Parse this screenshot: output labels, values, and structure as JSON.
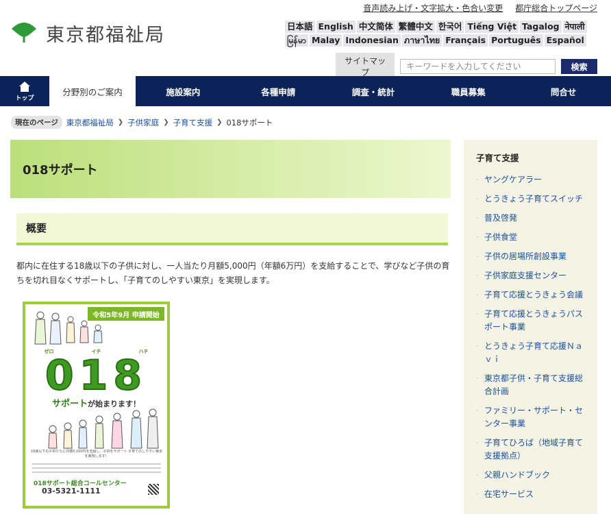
{
  "header": {
    "utility_links": [
      "音声読み上げ・文字拡大・色合い変更",
      "都庁総合トップページ"
    ],
    "logo_text": "東京都福祉局",
    "languages": [
      "日本語",
      "English",
      "中文简体",
      "繁體中文",
      "한국어",
      "Tiếng Việt",
      "Tagalog",
      "नेपाली",
      "မြန်မာ",
      "Malay",
      "Indonesian",
      "ภาษาไทย",
      "Français",
      "Português",
      "Español"
    ],
    "sitemap_label": "サイトマップ",
    "search_placeholder": "キーワードを入力してください",
    "search_button": "検索"
  },
  "nav": {
    "home_label": "トップ",
    "items": [
      "分野別のご案内",
      "施設案内",
      "各種申請",
      "調査・統計",
      "職員募集",
      "問合せ"
    ]
  },
  "breadcrumb": {
    "label": "現在のページ",
    "items": [
      "東京都福祉局",
      "子供家庭",
      "子育て支援"
    ],
    "current": "018サポート"
  },
  "main": {
    "title": "018サポート",
    "section_title": "概要",
    "body_text": "都内に在住する18歳以下の子供に対し、一人当たり月額5,000円（年額6万円）を支給することで、学びなど子供の育ちを切れ目なくサポートし、「子育てのしやすい東京」を実現します。",
    "poster": {
      "banner": "令和5年9月 申請開始",
      "kana": [
        "ゼロ",
        "イチ",
        "ハチ"
      ],
      "big_number": "018",
      "subtitle_strong": "サポート",
      "subtitle_rest": "が始まります！",
      "info_text": "18歳以下の子供たちに月額5,000円を支給し、子供をサポート 子育てのしやすい東京 を実現します！",
      "call_center": "018サポート総合コールセンター",
      "tel": "03-5321-1111"
    }
  },
  "sidebar": {
    "title": "子育て支援",
    "items": [
      "ヤングケアラー",
      "とうきょう子育てスイッチ",
      "普及啓発",
      "子供食堂",
      "子供の居場所創設事業",
      "子供家庭支援センター",
      "子育て応援とうきょう会議",
      "子育て応援とうきょうパスポート事業",
      "とうきょう子育て応援Ｎａｖｉ",
      "東京都子供・子育て支援総合計画",
      "ファミリー・サポート・センター事業",
      "子育てひろば（地域子育て支援拠点）",
      "父親ハンドブック",
      "在宅サービス"
    ]
  }
}
